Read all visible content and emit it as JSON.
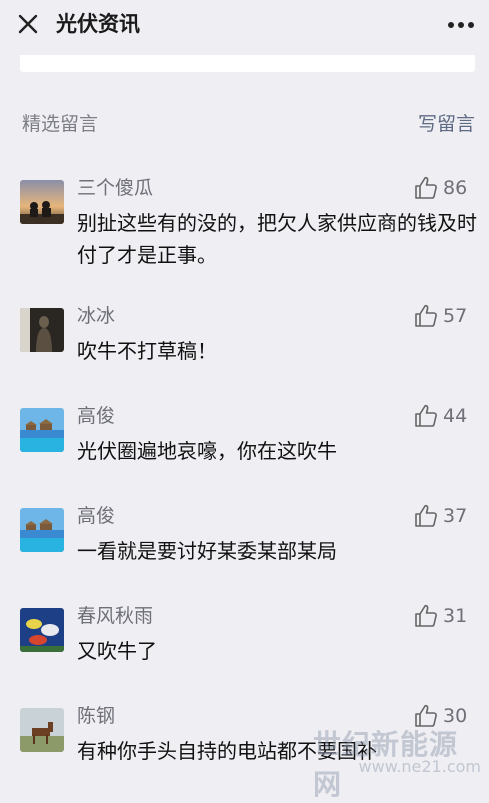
{
  "header": {
    "title": "光伏资讯",
    "close_icon": "close-icon",
    "more_icon": "more-dots-icon"
  },
  "section": {
    "title": "精选留言",
    "write_label": "写留言"
  },
  "comments": [
    {
      "nickname": "三个傻瓜",
      "likes": "86",
      "text": "别扯这些有的没的，把欠人家供应商的钱及时付了才是正事。",
      "avatar": "sunset-silhouette"
    },
    {
      "nickname": "冰冰",
      "likes": "57",
      "text": "吹牛不打草稿！",
      "avatar": "statue"
    },
    {
      "nickname": "高俊",
      "likes": "44",
      "text": "光伏圈遍地哀嚎，你在这吹牛",
      "avatar": "beach-resort"
    },
    {
      "nickname": "高俊",
      "likes": "37",
      "text": "一看就是要讨好某委某部某局",
      "avatar": "beach-resort"
    },
    {
      "nickname": "春风秋雨",
      "likes": "31",
      "text": "又吹牛了",
      "avatar": "fish-tank"
    },
    {
      "nickname": "陈钢",
      "likes": "30",
      "text": "有种你手头自持的电站都不要国补",
      "avatar": "horse-field"
    }
  ],
  "watermark": {
    "main": "世纪新能源网",
    "sub": "www.ne21.com"
  },
  "colors": {
    "background": "#eeeef3",
    "nickname": "#6f6f78",
    "content": "#111111",
    "link": "#5f6a83"
  }
}
